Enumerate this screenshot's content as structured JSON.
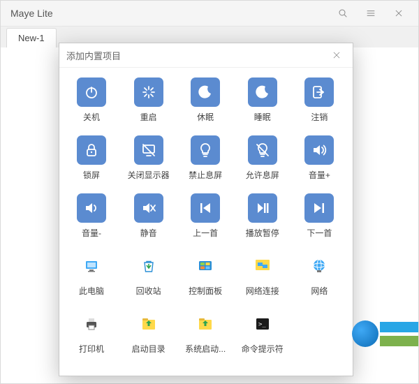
{
  "app": {
    "title": "Maye Lite",
    "tab": "New-1"
  },
  "dialog": {
    "title": "添加内置项目",
    "items": [
      {
        "label": "关机",
        "icon": "power",
        "style": "blue"
      },
      {
        "label": "重启",
        "icon": "restart",
        "style": "blue"
      },
      {
        "label": "休眠",
        "icon": "moon",
        "style": "blue"
      },
      {
        "label": "睡眠",
        "icon": "moon",
        "style": "blue"
      },
      {
        "label": "注销",
        "icon": "logout",
        "style": "blue"
      },
      {
        "label": "锁屏",
        "icon": "lock",
        "style": "blue"
      },
      {
        "label": "关闭显示器",
        "icon": "monitor-off",
        "style": "blue"
      },
      {
        "label": "禁止息屏",
        "icon": "bulb",
        "style": "blue"
      },
      {
        "label": "允许息屏",
        "icon": "bulb-off",
        "style": "blue"
      },
      {
        "label": "音量+",
        "icon": "vol-up",
        "style": "blue"
      },
      {
        "label": "音量-",
        "icon": "vol-down",
        "style": "blue"
      },
      {
        "label": "静音",
        "icon": "mute",
        "style": "blue"
      },
      {
        "label": "上一首",
        "icon": "prev",
        "style": "blue"
      },
      {
        "label": "播放暂停",
        "icon": "playpause",
        "style": "blue"
      },
      {
        "label": "下一首",
        "icon": "next",
        "style": "blue"
      },
      {
        "label": "此电脑",
        "icon": "thispc",
        "style": "sys"
      },
      {
        "label": "回收站",
        "icon": "recycle",
        "style": "sys"
      },
      {
        "label": "控制面板",
        "icon": "cpanel",
        "style": "sys"
      },
      {
        "label": "网络连接",
        "icon": "netconn",
        "style": "sys"
      },
      {
        "label": "网络",
        "icon": "network",
        "style": "sys"
      },
      {
        "label": "打印机",
        "icon": "printer",
        "style": "sys"
      },
      {
        "label": "启动目录",
        "icon": "startup",
        "style": "sys"
      },
      {
        "label": "系统启动...",
        "icon": "startup",
        "style": "sys"
      },
      {
        "label": "命令提示符",
        "icon": "cmd",
        "style": "sys"
      }
    ]
  }
}
